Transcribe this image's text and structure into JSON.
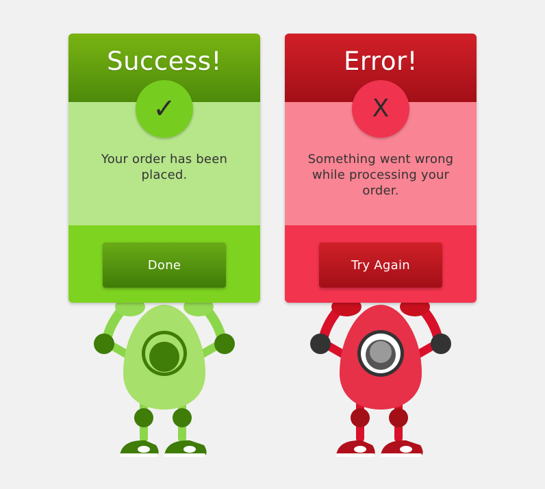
{
  "success_dialog": {
    "title": "Success!",
    "badge_icon": "check-icon",
    "badge_glyph": "✓",
    "message": "Your order has been placed.",
    "button_label": "Done",
    "colors": {
      "header": "#5d9a0c",
      "body": "#b6e58a",
      "footer": "#7ed321",
      "button": "#4f8c0c"
    }
  },
  "error_dialog": {
    "title": "Error!",
    "badge_icon": "x-icon",
    "badge_glyph": "X",
    "message": "Something went wrong while processing your order.",
    "button_label": "Try Again",
    "colors": {
      "header": "#bb1820",
      "body": "#f98493",
      "footer": "#f3344e",
      "button": "#b3141c"
    }
  },
  "mascots": {
    "green": {
      "name": "green-robot-mascot",
      "body": "#a7e06a",
      "joints": "#3f7c08"
    },
    "red": {
      "name": "red-robot-mascot",
      "body": "#e63148",
      "joints": "#b0101b"
    }
  }
}
